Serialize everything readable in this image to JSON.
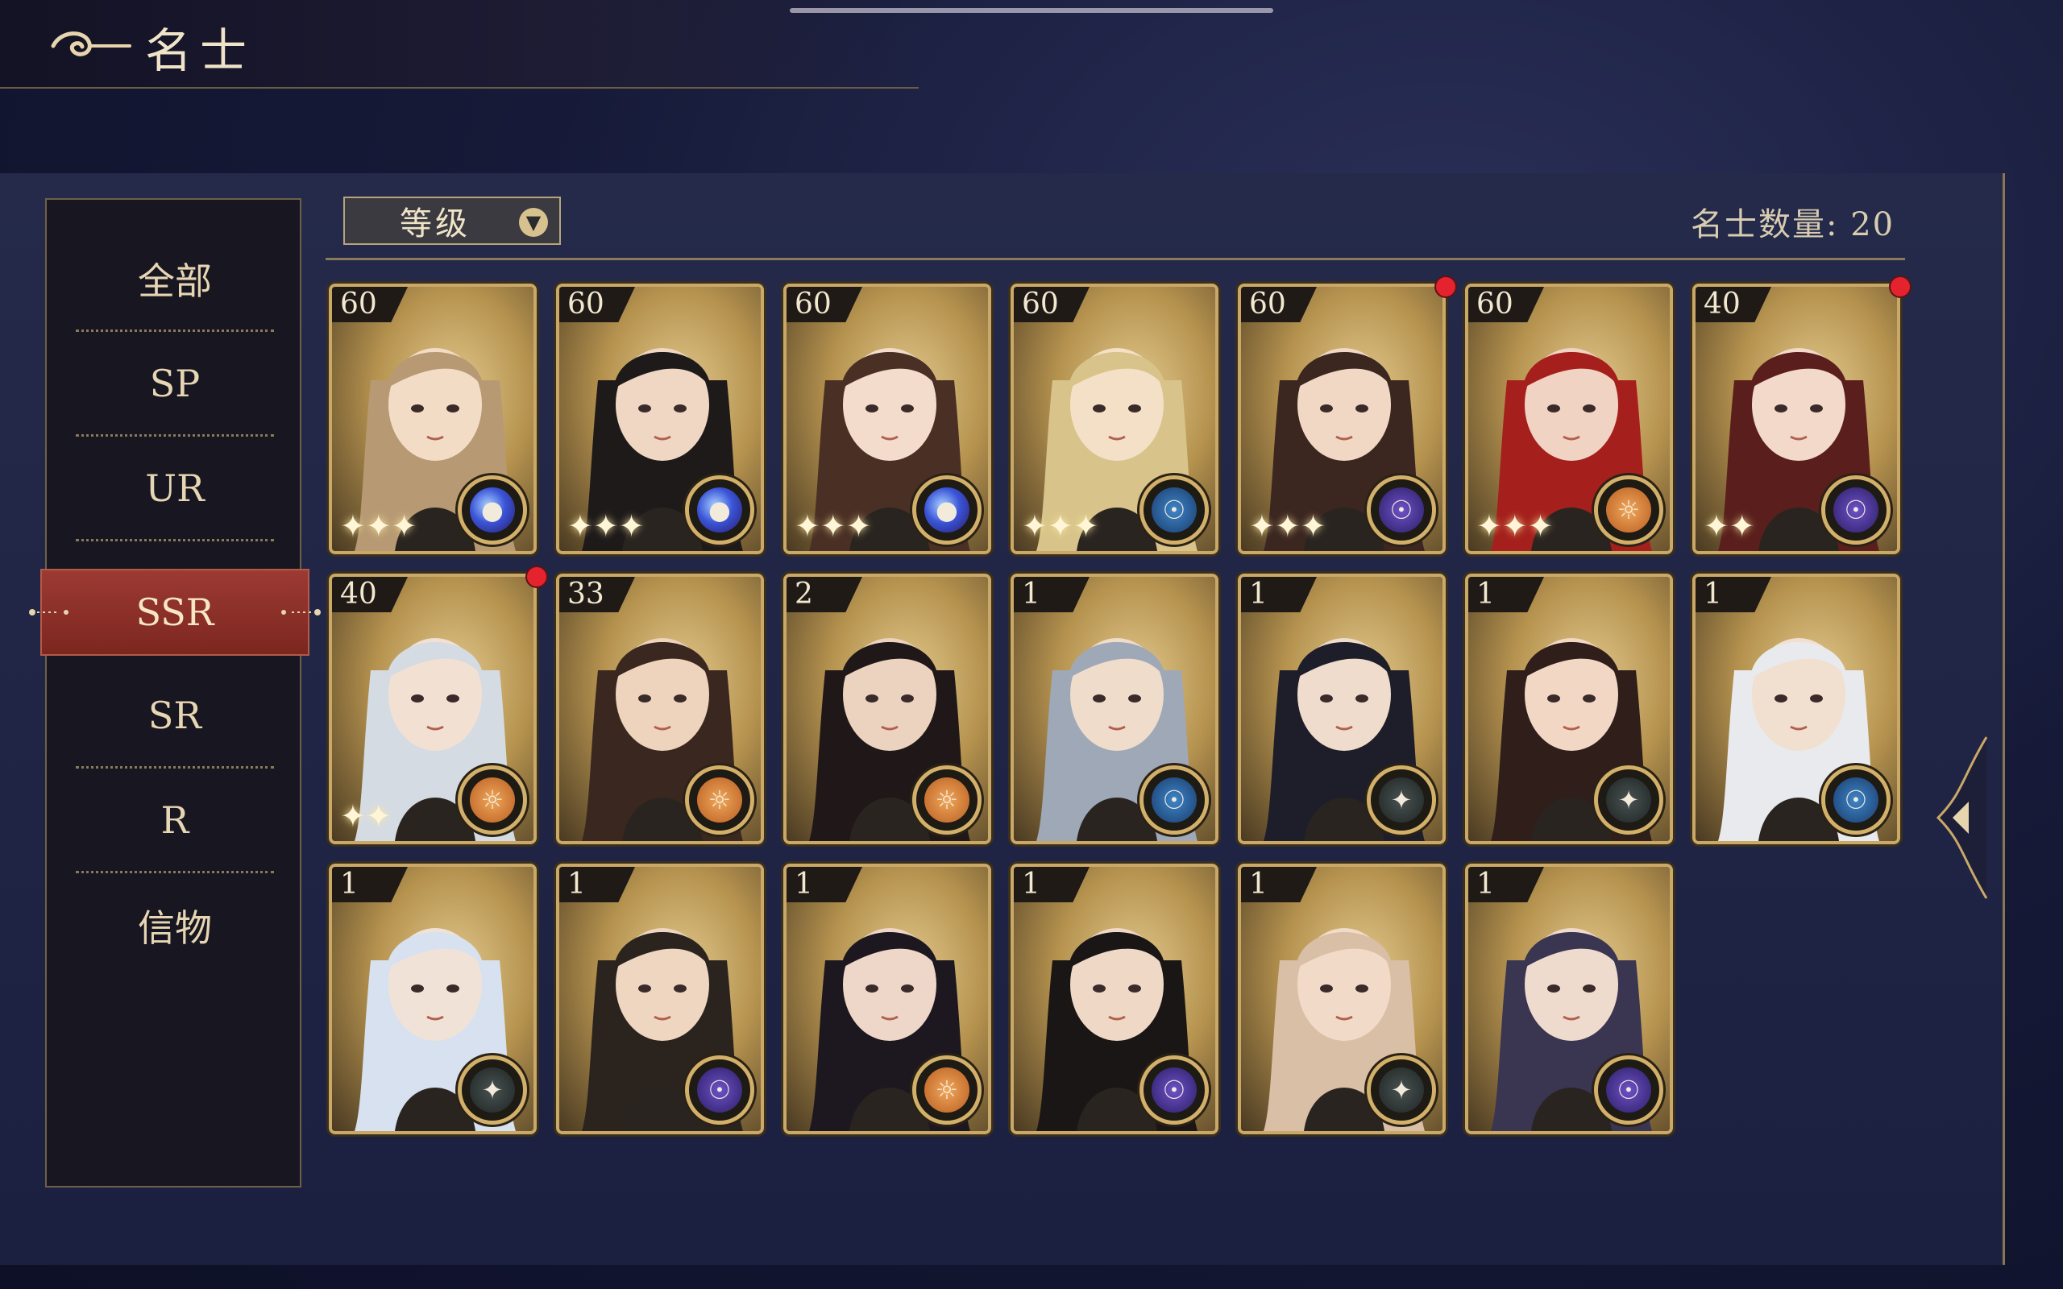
{
  "header": {
    "title": "名士"
  },
  "sidebar": {
    "items": [
      {
        "label": "全部",
        "active": false
      },
      {
        "label": "SP",
        "active": false
      },
      {
        "label": "UR",
        "active": false
      },
      {
        "label": "SSR",
        "active": true
      },
      {
        "label": "SR",
        "active": false
      },
      {
        "label": "R",
        "active": false
      },
      {
        "label": "信物",
        "active": false
      }
    ]
  },
  "filter": {
    "sort_label": "等级",
    "chevron_icon": "chevron-down-icon"
  },
  "count": {
    "text": "名士数量: 20"
  },
  "colors": {
    "accent_red": "#9c3a33",
    "gold": "#c9a868",
    "notify_red": "#e5232e"
  },
  "cards": [
    {
      "level": "60",
      "element": "cosmic",
      "stars": 3,
      "notify": false,
      "hair": "#b79a73",
      "skin": "#f3dcc6"
    },
    {
      "level": "60",
      "element": "cosmic",
      "stars": 3,
      "notify": false,
      "hair": "#1e1a1a",
      "skin": "#efd7c4"
    },
    {
      "level": "60",
      "element": "cosmic",
      "stars": 3,
      "notify": false,
      "hair": "#4a3024",
      "skin": "#f3dccb"
    },
    {
      "level": "60",
      "element": "planet-blue",
      "stars": 3,
      "notify": false,
      "hair": "#d8c48a",
      "skin": "#f4e0c6"
    },
    {
      "level": "60",
      "element": "planet-purple",
      "stars": 3,
      "notify": true,
      "hair": "#3b2620",
      "skin": "#f1d8c5"
    },
    {
      "level": "60",
      "element": "sun",
      "stars": 3,
      "notify": false,
      "hair": "#a5201c",
      "skin": "#f0d3c2"
    },
    {
      "level": "40",
      "element": "planet-purple",
      "stars": 2,
      "notify": true,
      "hair": "#5a1f1c",
      "skin": "#f3d9ca"
    },
    {
      "level": "40",
      "element": "sun",
      "stars": 2,
      "notify": true,
      "hair": "#d5dbe3",
      "skin": "#f2e0d3"
    },
    {
      "level": "33",
      "element": "sun",
      "stars": 0,
      "notify": false,
      "hair": "#3a2820",
      "skin": "#eed4bd"
    },
    {
      "level": "2",
      "element": "sun",
      "stars": 0,
      "notify": false,
      "hair": "#201818",
      "skin": "#ecd3c0"
    },
    {
      "level": "1",
      "element": "planet-blue",
      "stars": 0,
      "notify": false,
      "hair": "#9ea8b7",
      "skin": "#efdccb"
    },
    {
      "level": "1",
      "element": "compass",
      "stars": 0,
      "notify": false,
      "hair": "#1e1e2a",
      "skin": "#efdccc"
    },
    {
      "level": "1",
      "element": "compass",
      "stars": 0,
      "notify": false,
      "hair": "#2f1e1a",
      "skin": "#f2d8c4"
    },
    {
      "level": "1",
      "element": "planet-blue",
      "stars": 0,
      "notify": false,
      "hair": "#e9eaee",
      "skin": "#f1dfd0"
    },
    {
      "level": "1",
      "element": "compass",
      "stars": 0,
      "notify": false,
      "hair": "#d7e1ef",
      "skin": "#f1e2d8"
    },
    {
      "level": "1",
      "element": "planet-purple",
      "stars": 0,
      "notify": false,
      "hair": "#2b241e",
      "skin": "#eed6c1"
    },
    {
      "level": "1",
      "element": "sun",
      "stars": 0,
      "notify": false,
      "hair": "#1d1820",
      "skin": "#eed7c8"
    },
    {
      "level": "1",
      "element": "planet-purple",
      "stars": 0,
      "notify": false,
      "hair": "#1a1616",
      "skin": "#efd8c6"
    },
    {
      "level": "1",
      "element": "compass",
      "stars": 0,
      "notify": false,
      "hair": "#d9bfa6",
      "skin": "#f2dac8"
    },
    {
      "level": "1",
      "element": "planet-purple",
      "stars": 0,
      "notify": false,
      "hair": "#3a3550",
      "skin": "#efdace"
    }
  ]
}
